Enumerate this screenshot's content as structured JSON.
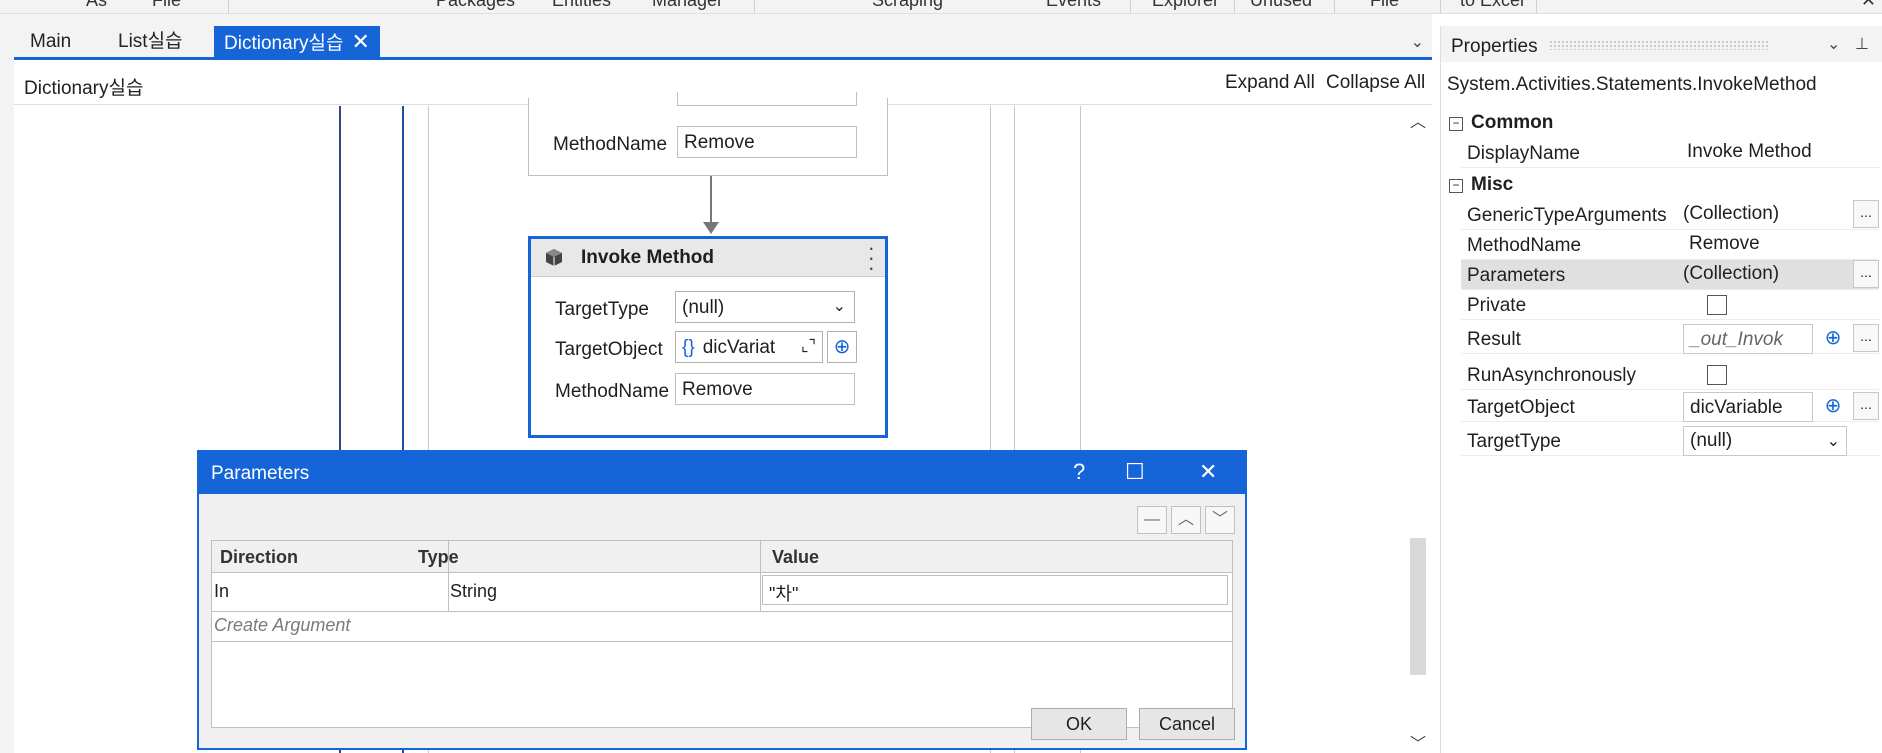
{
  "ribbon": {
    "items": [
      "As",
      "File",
      "Packages",
      "Entities",
      "Manager",
      "Scraping",
      "Events",
      "Explorer",
      "Unused",
      "File",
      "to Excel"
    ]
  },
  "tabs": [
    {
      "label": "Main",
      "active": false
    },
    {
      "label": "List실습",
      "active": false
    },
    {
      "label": "Dictionary실습",
      "active": true
    }
  ],
  "designer": {
    "title": "Dictionary실습",
    "expand_all": "Expand All",
    "collapse_all": "Collapse All"
  },
  "upper_activity": {
    "method_label": "MethodName",
    "method_value": "Remove"
  },
  "invoke_method": {
    "title": "Invoke Method",
    "target_type_label": "TargetType",
    "target_type_value": "(null)",
    "target_object_label": "TargetObject",
    "target_object_value": "dicVariat",
    "method_name_label": "MethodName",
    "method_name_value": "Remove"
  },
  "dialog": {
    "title": "Parameters",
    "help": "?",
    "columns": [
      "Direction",
      "Type",
      "Value"
    ],
    "rows": [
      {
        "direction": "In",
        "type": "String",
        "value": "\"차\""
      }
    ],
    "create_argument": "Create Argument",
    "ok_label": "OK",
    "cancel_label": "Cancel"
  },
  "properties": {
    "title": "Properties",
    "type_name": "System.Activities.Statements.InvokeMethod",
    "categories": {
      "common": "Common",
      "misc": "Misc"
    },
    "display_name": {
      "name": "DisplayName",
      "value": "Invoke Method"
    },
    "generic_type_arguments": {
      "name": "GenericTypeArguments",
      "value": "(Collection)"
    },
    "method_name": {
      "name": "MethodName",
      "value": "Remove"
    },
    "parameters": {
      "name": "Parameters",
      "value": "(Collection)"
    },
    "private": {
      "name": "Private"
    },
    "result": {
      "name": "Result",
      "value": "_out_Invok"
    },
    "run_asynchronously": {
      "name": "RunAsynchronously"
    },
    "target_object": {
      "name": "TargetObject",
      "value": "dicVariable"
    },
    "target_type": {
      "name": "TargetType",
      "value": "(null)"
    },
    "ellipsis": "..."
  },
  "colors": {
    "accent": "#1565d8",
    "selected_row": "#e0e0e0"
  }
}
